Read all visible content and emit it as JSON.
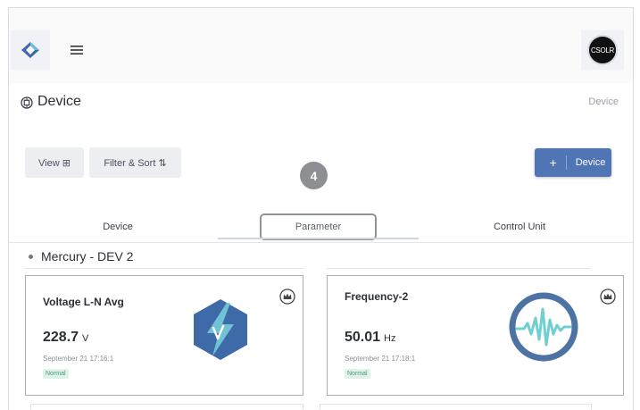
{
  "header": {
    "logo_icon": "brand-logo-icon",
    "menu_icon": "hamburger-menu-icon",
    "avatar_text": "CSOLR"
  },
  "page": {
    "title": "Device",
    "title_icon": "chip-icon",
    "breadcrumb": "Device"
  },
  "toolbar": {
    "view_label": "View ⊞",
    "filter_label": "Filter & Sort ⇅",
    "add_plus": "+",
    "add_label": "Device"
  },
  "step_marker": "4",
  "tabs": [
    {
      "label": "Device"
    },
    {
      "label": "Parameter"
    },
    {
      "label": "Control Unit"
    }
  ],
  "group": {
    "title": "Mercury - DEV 2"
  },
  "cards": [
    {
      "name": "Voltage L-N Avg",
      "value": "228.7",
      "unit": "V",
      "time": "September 21 17:16:1",
      "status": "Normal",
      "art_icon": "voltage-bolt-icon",
      "art_color": "#3f6aa8"
    },
    {
      "name": "Frequency-2",
      "value": "50.01",
      "unit": "Hz",
      "time": "September 21 17:18:1",
      "status": "Normal",
      "art_icon": "waveform-icon",
      "art_color": "#4d72a4",
      "wave_color": "#6fd0cf"
    }
  ],
  "colors": {
    "accent": "#4f75b5",
    "status_normal": "#4a9c72"
  }
}
